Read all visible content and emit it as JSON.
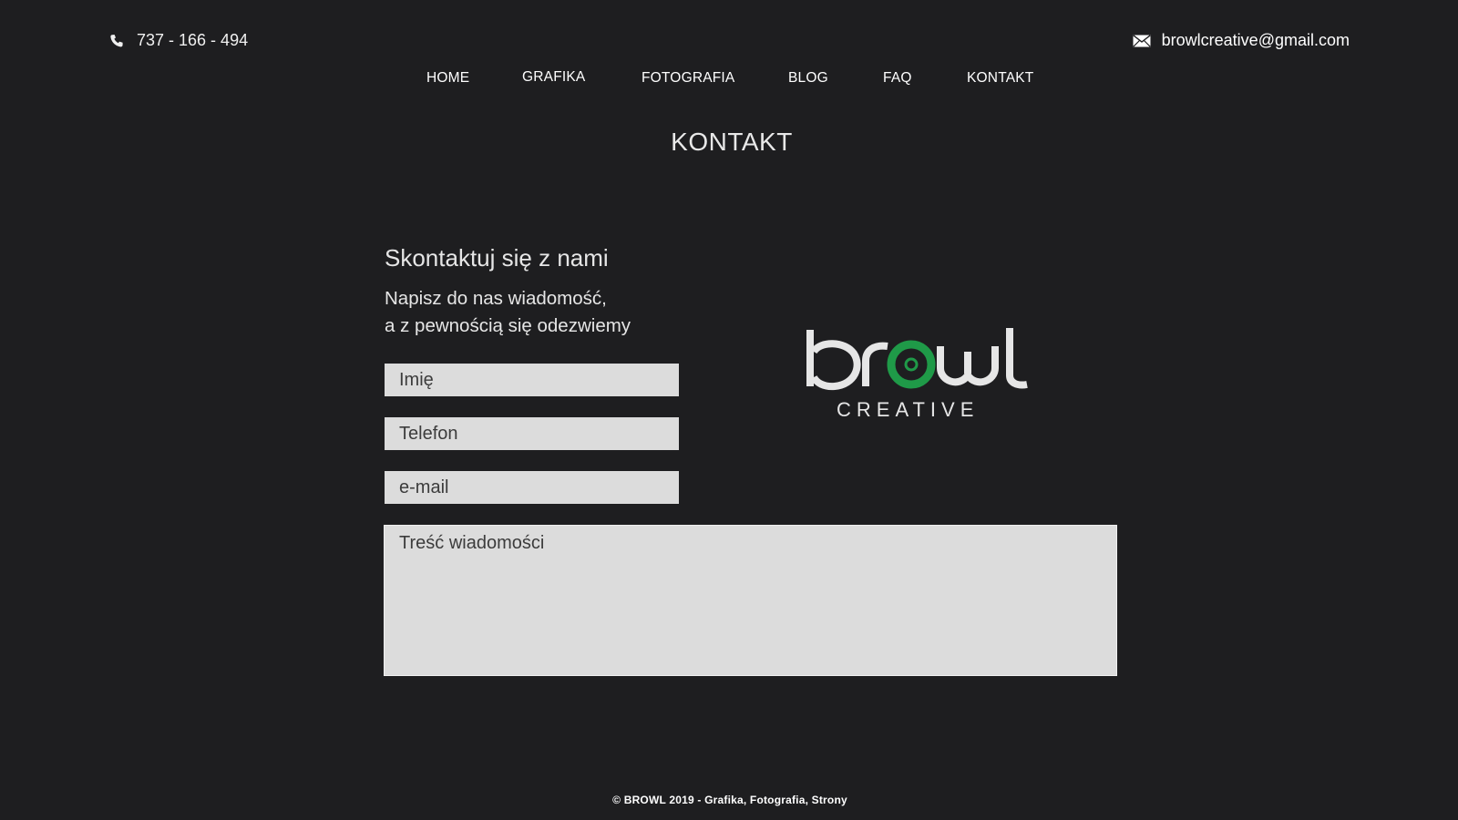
{
  "topbar": {
    "phone_icon": "phone-icon",
    "phone": "737 - 166 - 494",
    "mail_icon": "envelope-icon",
    "email": "browlcreative@gmail.com"
  },
  "nav": {
    "items": [
      {
        "label": "HOME"
      },
      {
        "label": "GRAFIKA"
      },
      {
        "label": "FOTOGRAFIA"
      },
      {
        "label": "BLOG"
      },
      {
        "label": "FAQ"
      },
      {
        "label": "KONTAKT"
      }
    ]
  },
  "page": {
    "title": "KONTAKT"
  },
  "contact": {
    "heading": "Skontaktuj się z nami",
    "subline1": "Napisz do nas wiadomość,",
    "subline2": "a z pewnością się odezwiemy",
    "fields": {
      "name_placeholder": "Imię",
      "phone_placeholder": "Telefon",
      "email_placeholder": "e-mail",
      "message_placeholder": "Treść wiadomości"
    }
  },
  "logo": {
    "wordmark": "browl",
    "tagline": "CREATIVE",
    "accent_color": "#1f9a48",
    "text_color": "#e6e6e6"
  },
  "footer": {
    "text": "©  BROWL 2019 - Grafika, Fotografia, Strony"
  }
}
